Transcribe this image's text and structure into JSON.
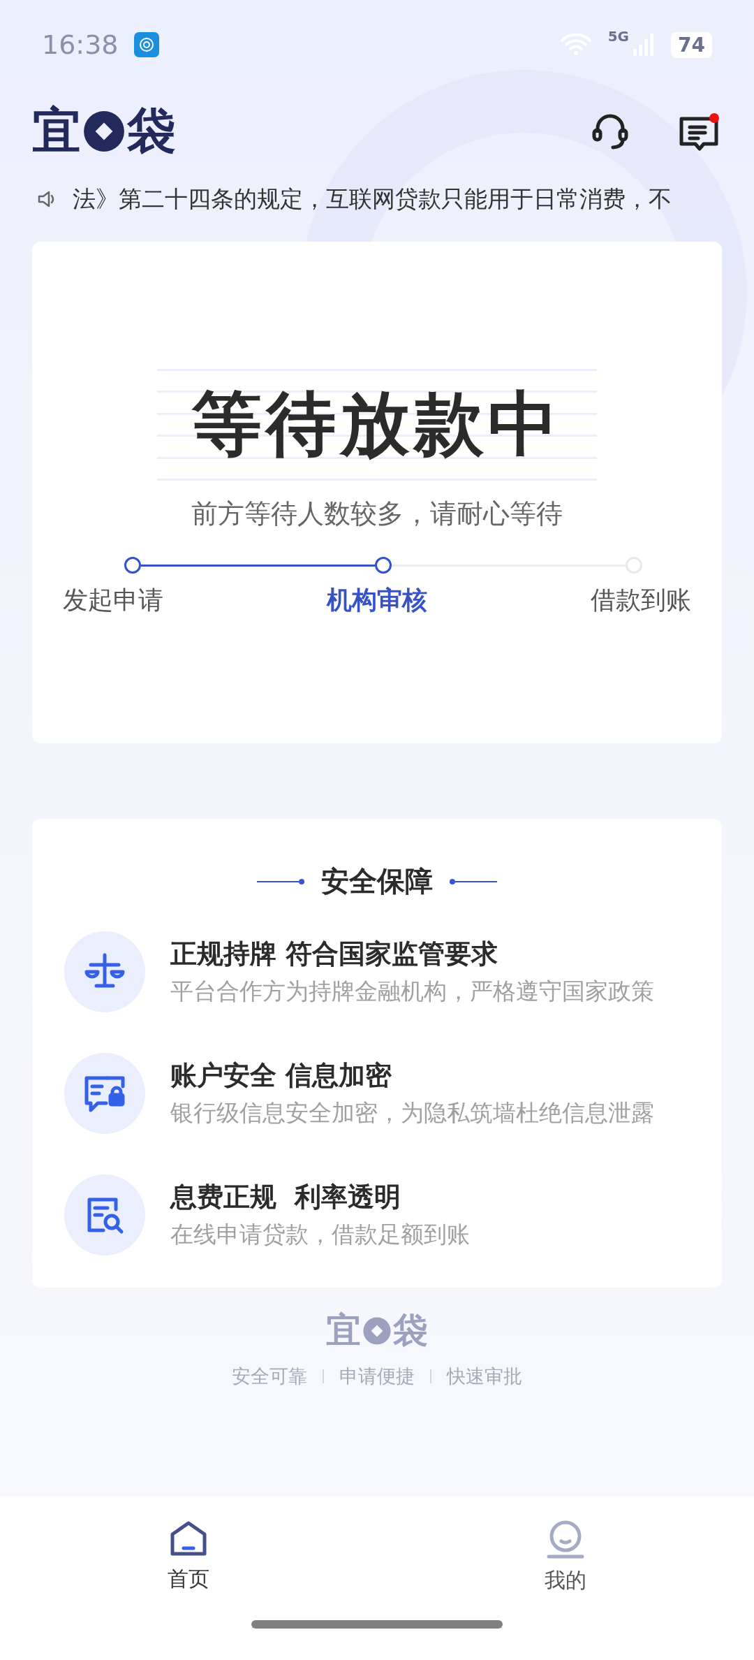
{
  "status_bar": {
    "time": "16:38",
    "network": "5G",
    "battery": "74"
  },
  "header": {
    "logo": {
      "first": "宜",
      "last": "袋"
    },
    "message_badge": true
  },
  "notice": {
    "text": "法》第二十四条的规定，互联网贷款只能用于日常消费，不"
  },
  "status_card": {
    "title": "等待放款中",
    "subtitle": "前方等待人数较多，请耐心等待",
    "steps": [
      {
        "label": "发起申请",
        "reached": true,
        "selected": false
      },
      {
        "label": "机构审核",
        "reached": true,
        "selected": true
      },
      {
        "label": "借款到账",
        "reached": false,
        "selected": false
      }
    ]
  },
  "security": {
    "title": "安全保障",
    "items": [
      {
        "title": "正规持牌 符合国家监管要求",
        "description": "平台合作方为持牌金融机构，严格遵守国家政策"
      },
      {
        "title": "账户安全 信息加密",
        "description": "银行级信息安全加密，为隐私筑墙杜绝信息泄露"
      },
      {
        "title": "息费正规  利率透明",
        "description": "在线申请贷款，借款足额到账"
      }
    ]
  },
  "footer": {
    "logo": {
      "first": "宜",
      "last": "袋"
    },
    "taglines": [
      "安全可靠",
      "申请便捷",
      "快速审批"
    ]
  },
  "tab_bar": [
    {
      "label": "首页",
      "selected": true
    },
    {
      "label": "我的",
      "selected": false
    }
  ]
}
